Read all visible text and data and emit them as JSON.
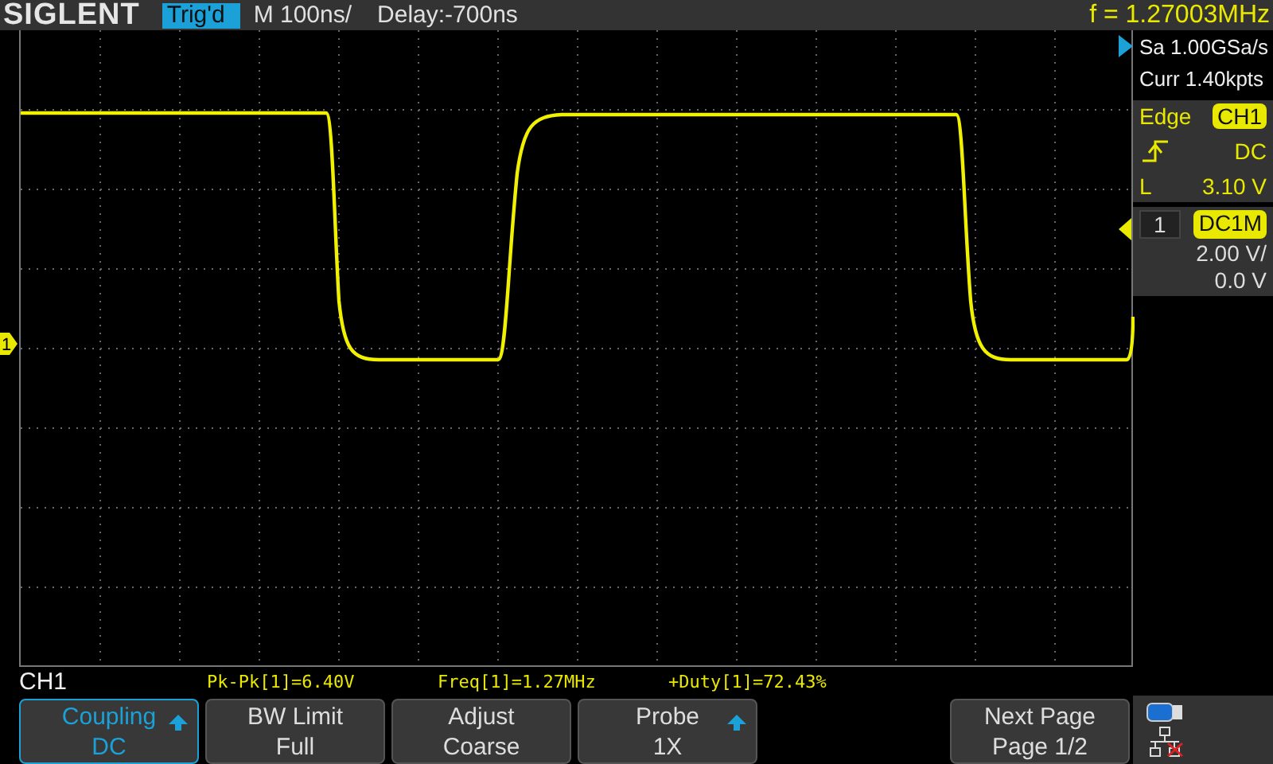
{
  "header": {
    "logo": "SIGLENT",
    "status": "Trig'd",
    "timebase": "M 100ns/",
    "delay": "Delay:-700ns",
    "frequency": "f = 1.27003MHz"
  },
  "acquisition": {
    "sample_rate": "Sa 1.00GSa/s",
    "memory": "Curr 1.40kpts"
  },
  "trigger": {
    "type": "Edge",
    "source": "CH1",
    "coupling": "DC",
    "level_label": "L",
    "level_reading": "3.10 V"
  },
  "channel": {
    "number": "1",
    "coupling": "DC1M",
    "scale": "2.00 V/",
    "offset": "0.0 V"
  },
  "channel_marker": "1",
  "menu_title": "CH1",
  "measurements": [
    "Pk-Pk[1]=6.40V",
    "Freq[1]=1.27MHz",
    "+Duty[1]=72.43%"
  ],
  "softkeys": [
    {
      "kind": "key",
      "label": "Coupling",
      "value": "DC",
      "selected": true,
      "has_arrow": true
    },
    {
      "kind": "key",
      "label": "BW Limit",
      "value": "Full",
      "selected": false,
      "has_arrow": false
    },
    {
      "kind": "key",
      "label": "Adjust",
      "value": "Coarse",
      "selected": false,
      "has_arrow": false
    },
    {
      "kind": "key",
      "label": "Probe",
      "value": "1X",
      "selected": false,
      "has_arrow": true
    },
    {
      "kind": "blank"
    },
    {
      "kind": "key",
      "label": "Next Page",
      "value": "Page 1/2",
      "selected": false,
      "has_arrow": false
    }
  ]
}
